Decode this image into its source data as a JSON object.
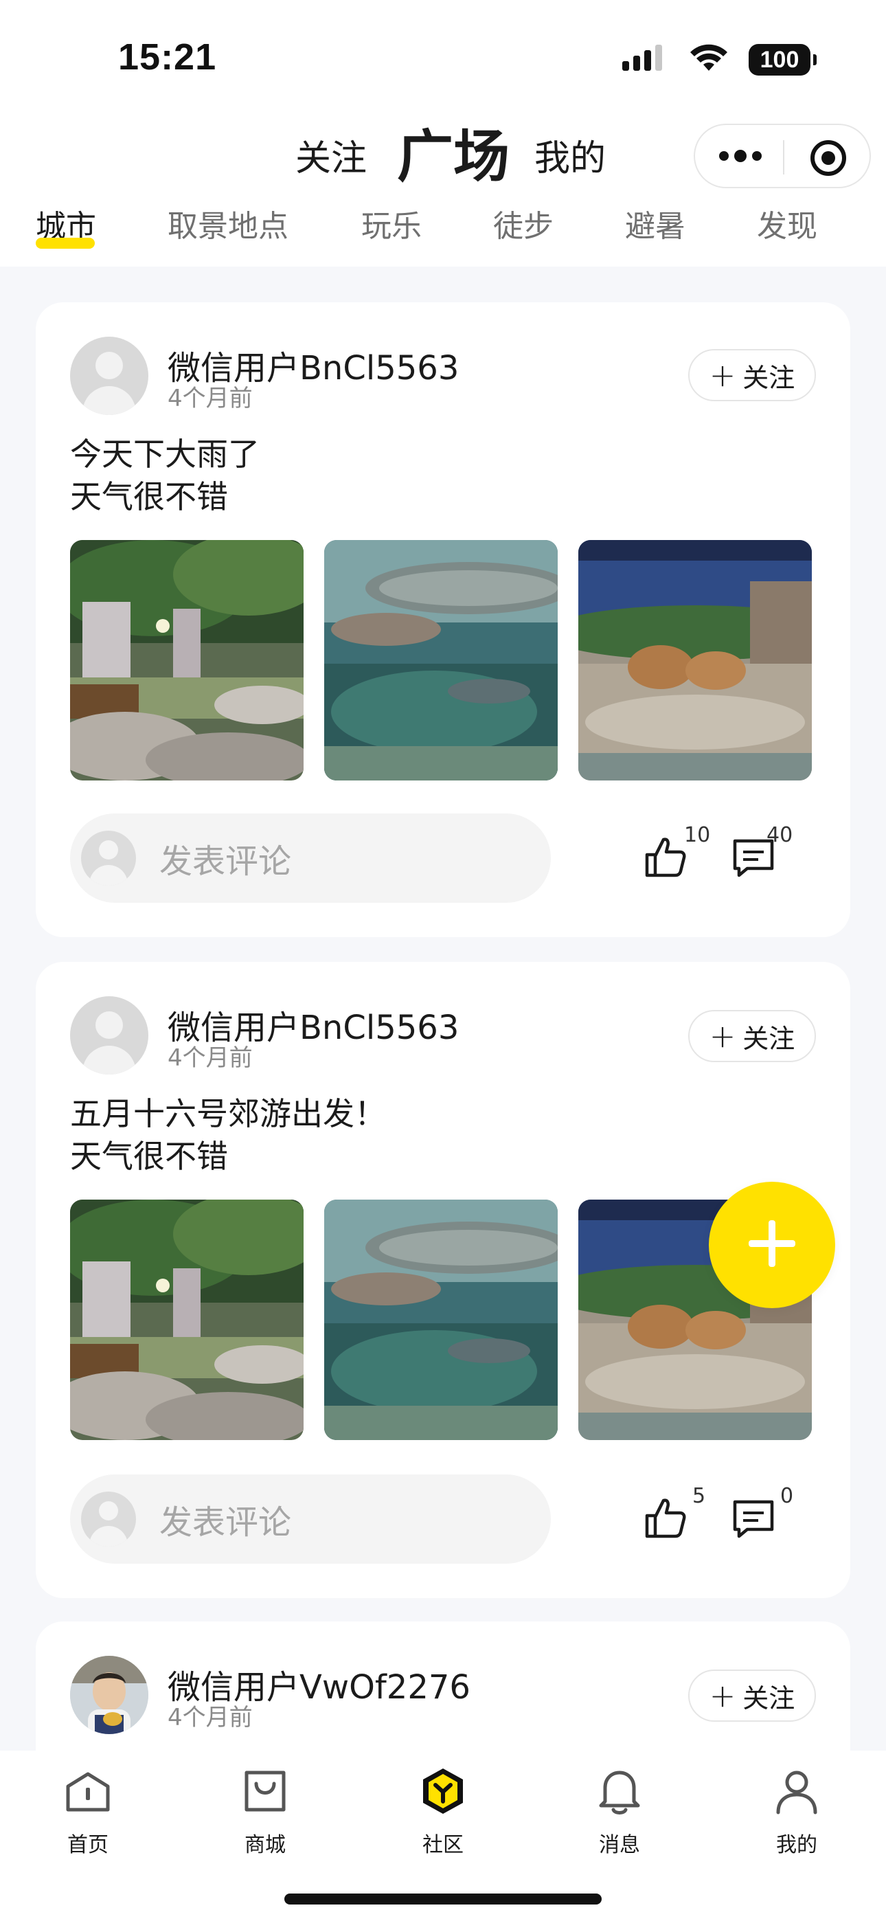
{
  "status_bar": {
    "time": "15:21",
    "battery": "100"
  },
  "header": {
    "tab_follow": "关注",
    "tab_square": "广场",
    "tab_mine": "我的",
    "capsule_more_icon": "more-dots-icon",
    "capsule_close_icon": "target-circle-icon"
  },
  "categories": [
    {
      "label": "城市",
      "active": true
    },
    {
      "label": "取景地点",
      "active": false
    },
    {
      "label": "玩乐",
      "active": false
    },
    {
      "label": "徒步",
      "active": false
    },
    {
      "label": "避暑",
      "active": false
    },
    {
      "label": "发现",
      "active": false
    }
  ],
  "colors": {
    "accent": "#ffe100",
    "page_bg": "#f6f7fa",
    "card_bg": "#ffffff",
    "secondary_text": "#8a8a8a"
  },
  "posts": [
    {
      "username": "微信用户BnCl5563",
      "time_ago": "4个月前",
      "follow_label": "关注",
      "text": "今天下大雨了\n天气很不错",
      "photos": [
        "forest-pond-photo",
        "arapaima-aquarium-photo",
        "capybara-photo"
      ],
      "comment_placeholder": "发表评论",
      "likes": "10",
      "comments": "40"
    },
    {
      "username": "微信用户BnCl5563",
      "time_ago": "4个月前",
      "follow_label": "关注",
      "text": "五月十六号郊游出发！\n天气很不错",
      "photos": [
        "forest-pond-photo",
        "arapaima-aquarium-photo",
        "capybara-photo"
      ],
      "comment_placeholder": "发表评论",
      "likes": "5",
      "comments": "0"
    },
    {
      "username": "微信用户VwOf2276",
      "time_ago": "4个月前",
      "follow_label": "关注"
    }
  ],
  "fab": {
    "icon": "plus-icon"
  },
  "tabbar": [
    {
      "label": "首页",
      "icon": "home-icon",
      "active": false
    },
    {
      "label": "商城",
      "icon": "shopping-bag-icon",
      "active": false
    },
    {
      "label": "社区",
      "icon": "community-icon",
      "active": true
    },
    {
      "label": "消息",
      "icon": "bell-icon",
      "active": false
    },
    {
      "label": "我的",
      "icon": "profile-icon",
      "active": false
    }
  ]
}
